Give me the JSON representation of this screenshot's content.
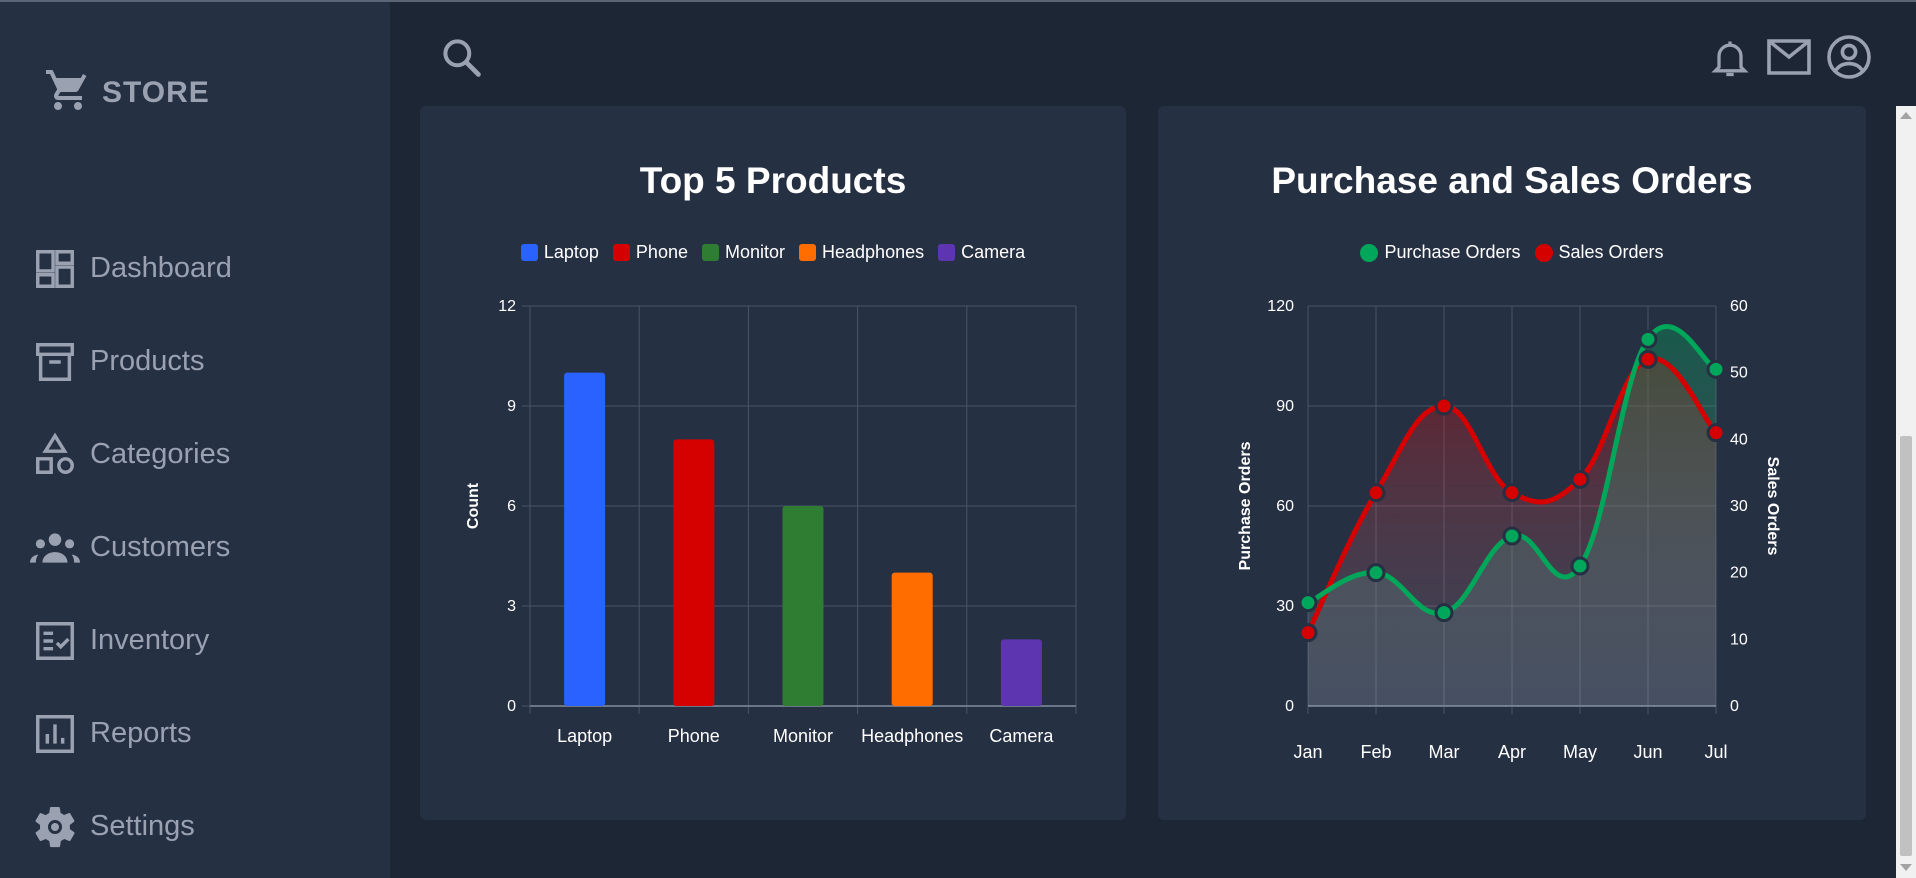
{
  "brand": {
    "name": "STORE",
    "icon": "cart-icon"
  },
  "sidebar": {
    "items": [
      {
        "label": "Dashboard",
        "icon": "dashboard-icon"
      },
      {
        "label": "Products",
        "icon": "archive-icon"
      },
      {
        "label": "Categories",
        "icon": "shapes-icon"
      },
      {
        "label": "Customers",
        "icon": "people-icon"
      },
      {
        "label": "Inventory",
        "icon": "checklist-icon"
      },
      {
        "label": "Reports",
        "icon": "bar-chart-icon"
      },
      {
        "label": "Settings",
        "icon": "gear-icon"
      }
    ]
  },
  "header": {
    "icons": [
      "search-icon",
      "bell-icon",
      "mail-icon",
      "account-circle-icon"
    ]
  },
  "colors": {
    "sidebar": "#263043",
    "background": "#1d2634",
    "card": "#263043"
  },
  "chart_data": [
    {
      "type": "bar",
      "title": "Top 5 Products",
      "categories": [
        "Laptop",
        "Phone",
        "Monitor",
        "Headphones",
        "Camera"
      ],
      "values": [
        10,
        8,
        6,
        4,
        2
      ],
      "colors": [
        "#2962ff",
        "#d50000",
        "#2e7d32",
        "#ff6d00",
        "#5e35b1"
      ],
      "legend": [
        "Laptop",
        "Phone",
        "Monitor",
        "Headphones",
        "Camera"
      ],
      "ylabel": "Count",
      "ylim": [
        0,
        12
      ],
      "yticks": [
        "0",
        "3",
        "6",
        "9",
        "12"
      ],
      "grid": true,
      "legend_position": "top"
    },
    {
      "type": "line",
      "title": "Purchase and Sales Orders",
      "x": [
        "Jan",
        "Feb",
        "Mar",
        "Apr",
        "May",
        "Jun",
        "Jul"
      ],
      "series": [
        {
          "name": "Purchase Orders",
          "axis": "left",
          "color": "#00a65a",
          "values": [
            31,
            40,
            28,
            51,
            42,
            110,
            101
          ]
        },
        {
          "name": "Sales Orders",
          "axis": "right",
          "color": "#d50000",
          "values": [
            11,
            32,
            45,
            32,
            34,
            52,
            41
          ]
        }
      ],
      "ylabel_left": "Purchase Orders",
      "ylabel_right": "Sales Orders",
      "ylim_left": [
        0,
        120
      ],
      "ylim_right": [
        0,
        60
      ],
      "yticks_left": [
        "0",
        "30",
        "60",
        "90",
        "120"
      ],
      "yticks_right": [
        "0",
        "10",
        "20",
        "30",
        "40",
        "50",
        "60"
      ],
      "grid": true,
      "legend_position": "top"
    }
  ]
}
